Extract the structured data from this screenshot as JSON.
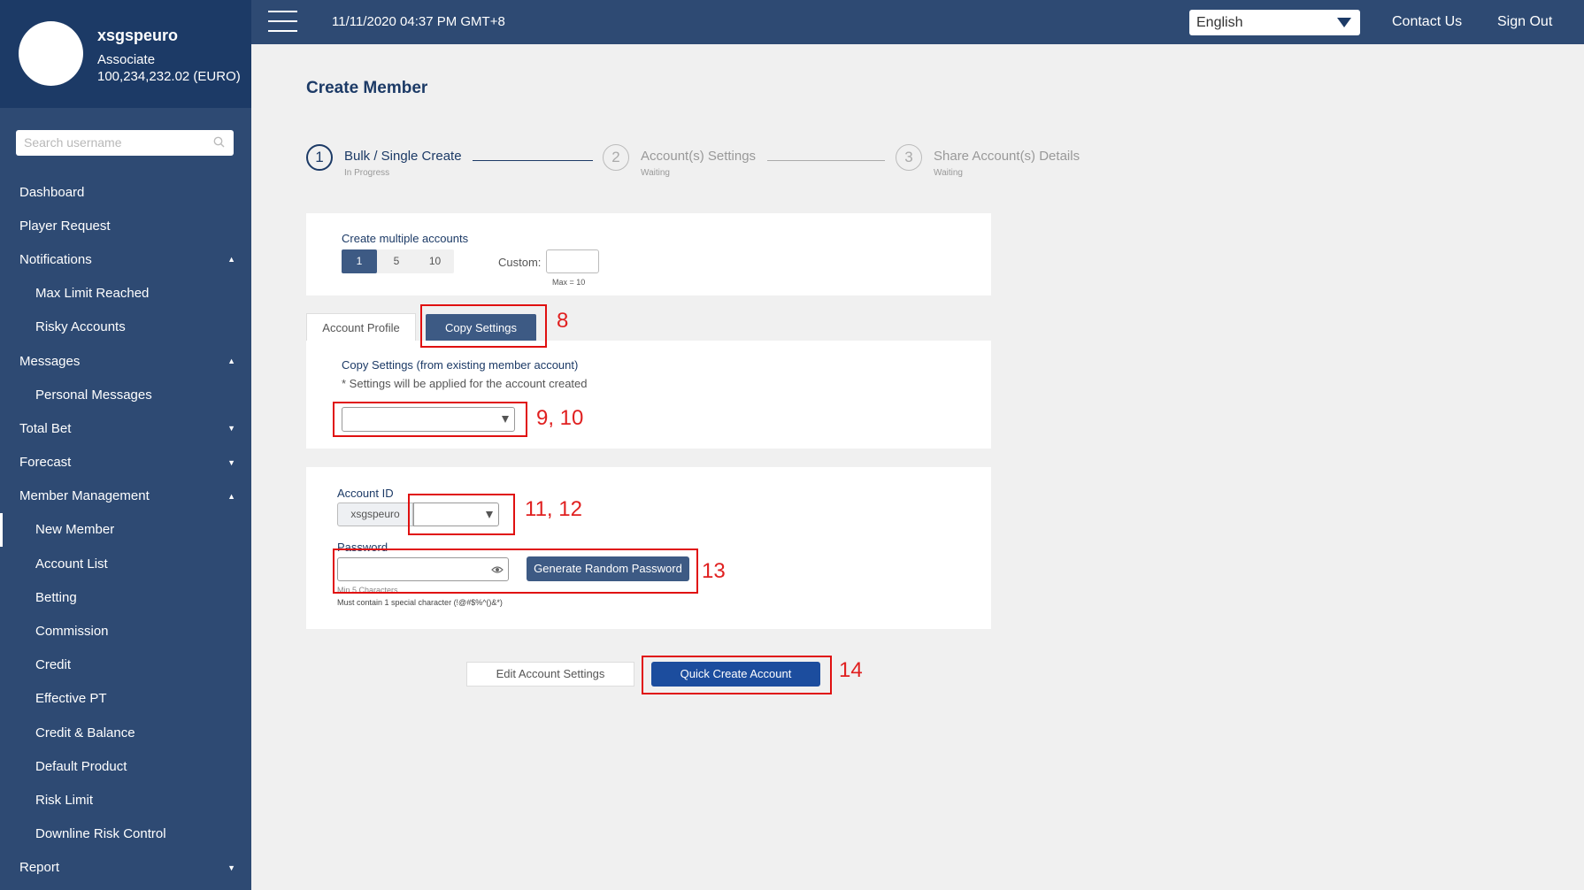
{
  "user": {
    "name": "xsgspeuro",
    "role": "Associate",
    "balance": "100,234,232.02 (EURO)"
  },
  "search": {
    "placeholder": "Search username"
  },
  "nav": [
    {
      "label": "Dashboard"
    },
    {
      "label": "Player Request"
    },
    {
      "label": "Notifications",
      "caret": "▲"
    },
    {
      "label": "Max Limit Reached"
    },
    {
      "label": "Risky Accounts"
    },
    {
      "label": "Messages",
      "caret": "▲"
    },
    {
      "label": "Personal Messages"
    },
    {
      "label": "Total Bet",
      "caret": "▼"
    },
    {
      "label": "Forecast",
      "caret": "▼"
    },
    {
      "label": "Member Management",
      "caret": "▲"
    },
    {
      "label": "New Member"
    },
    {
      "label": "Account List"
    },
    {
      "label": "Betting"
    },
    {
      "label": "Commission"
    },
    {
      "label": "Credit"
    },
    {
      "label": "Effective PT"
    },
    {
      "label": "Credit & Balance"
    },
    {
      "label": "Default Product"
    },
    {
      "label": "Risk Limit"
    },
    {
      "label": "Downline Risk Control"
    },
    {
      "label": "Report",
      "caret": "▼"
    }
  ],
  "topbar": {
    "datetime": "11/11/2020 04:37 PM GMT+8",
    "language": "English",
    "contact": "Contact Us",
    "signout": "Sign Out"
  },
  "page": {
    "title": "Create Member"
  },
  "steps": [
    {
      "num": "1",
      "label": "Bulk / Single Create",
      "status": "In Progress"
    },
    {
      "num": "2",
      "label": "Account(s) Settings",
      "status": "Waiting"
    },
    {
      "num": "3",
      "label": "Share Account(s) Details",
      "status": "Waiting"
    }
  ],
  "create": {
    "title": "Create multiple accounts",
    "options": [
      "1",
      "5",
      "10"
    ],
    "selected": "1",
    "custom_label": "Custom:",
    "max_note": "Max = 10"
  },
  "tabs": {
    "profile": "Account Profile",
    "copy": "Copy Settings"
  },
  "copy_settings": {
    "title": "Copy Settings (from existing member account)",
    "note": "* Settings will be applied for the account created"
  },
  "account": {
    "id_label": "Account ID",
    "prefix": "xsgspeuro",
    "password_label": "Password",
    "generate_btn": "Generate Random Password",
    "hint1": "Min 5 Characters",
    "hint2": "Must contain 1 special character (!@#$%^()&*)"
  },
  "actions": {
    "edit": "Edit Account Settings",
    "quick": "Quick Create Account"
  },
  "annotations": {
    "a8": "8",
    "a9": "9, 10",
    "a11": "11, 12",
    "a13": "13",
    "a14": "14"
  }
}
